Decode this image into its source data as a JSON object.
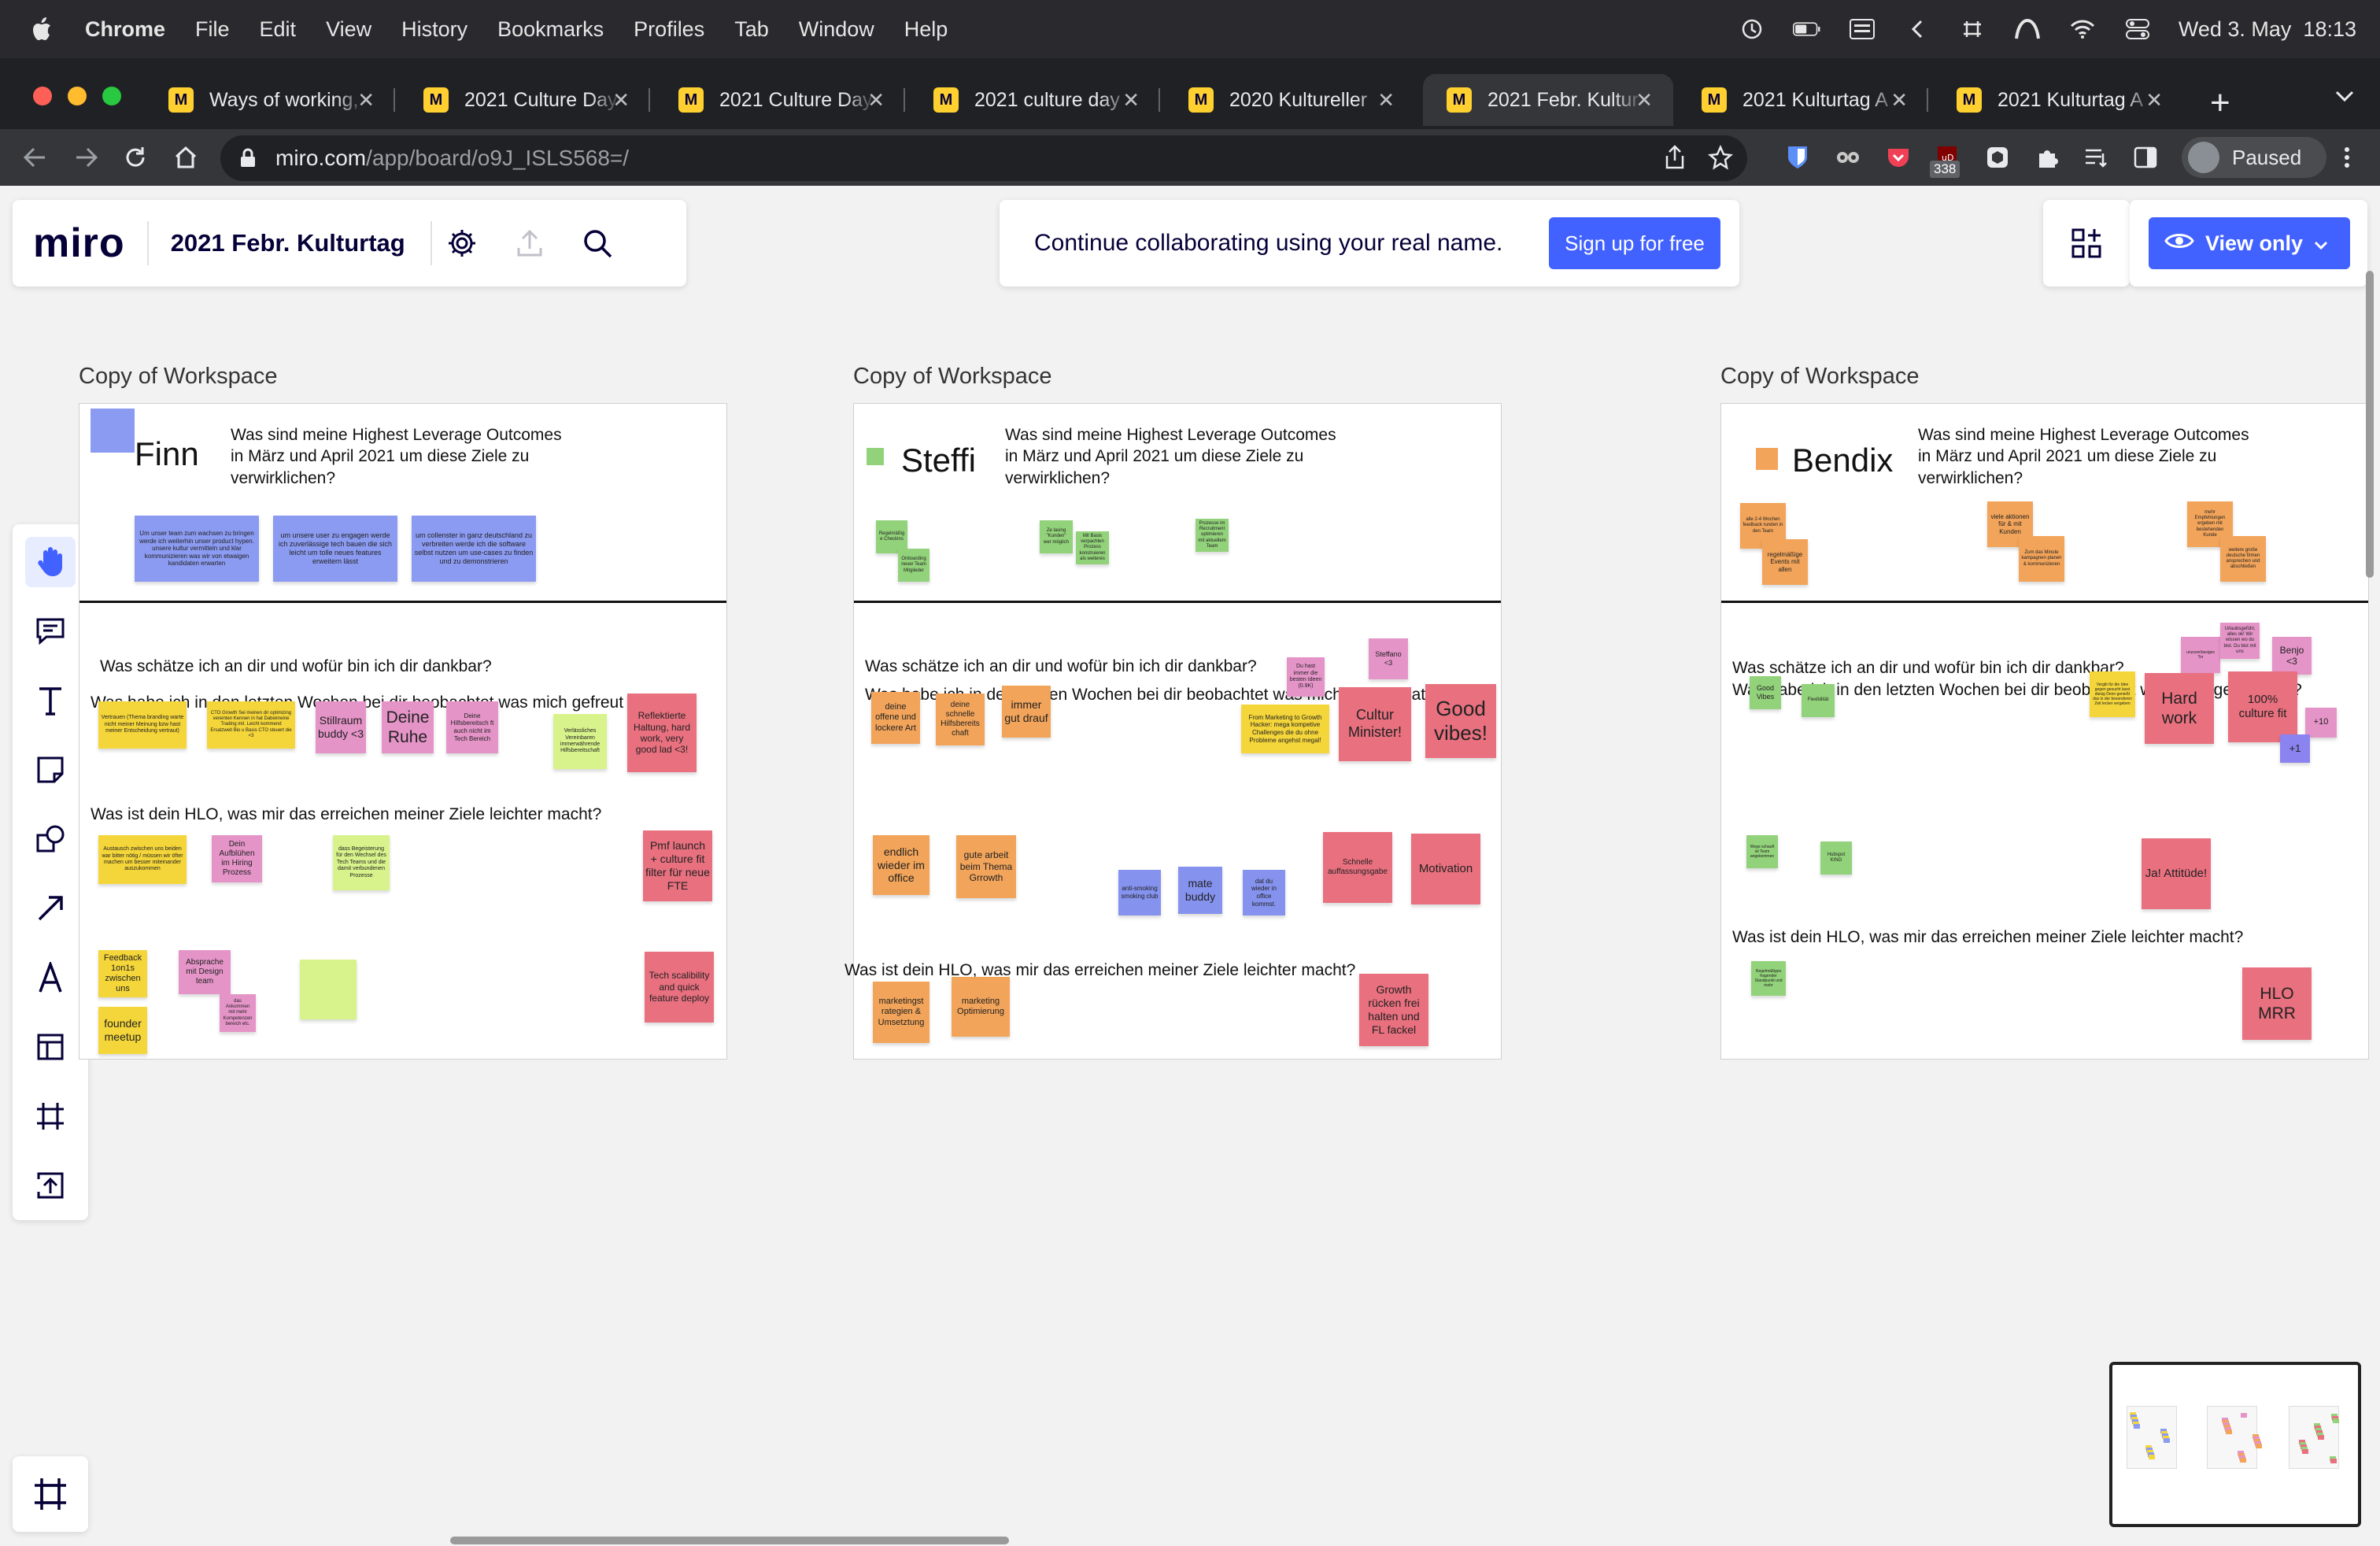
{
  "menubar": {
    "app": "Chrome",
    "items": [
      "File",
      "Edit",
      "View",
      "History",
      "Bookmarks",
      "Profiles",
      "Tab",
      "Window",
      "Help"
    ],
    "datetime": "Wed 3. May  18:13"
  },
  "tabs": [
    {
      "title": "Ways of working,"
    },
    {
      "title": "2021 Culture Day"
    },
    {
      "title": "2021 Culture Day"
    },
    {
      "title": "2021 culture day"
    },
    {
      "title": "2020 Kultureller"
    },
    {
      "title": "2021 Febr. Kultur"
    },
    {
      "title": "2021 Kulturtag A"
    },
    {
      "title": "2021 Kulturtag A"
    }
  ],
  "address": {
    "host": "miro.com",
    "path": "/app/board/o9J_ISLS568=/"
  },
  "profile": {
    "label": "Paused",
    "badge": "338"
  },
  "miro": {
    "logo": "miro",
    "board_title": "2021 Febr. Kulturtag",
    "signup_text": "Continue collaborating using your real name.",
    "signup_button": "Sign up for free",
    "view_button": "View only"
  },
  "frames": [
    {
      "label": "Copy of Workspace",
      "name": "Finn",
      "accent": "#8c9bf2",
      "q1": "Was sind meine Highest Leverage Outcomes in März und April 2021 um diese Ziele zu verwirklichen?",
      "q2": "Was schätze ich an dir und wofür bin ich dir dankbar?",
      "q3": "Was habe ich in den letzten Wochen bei dir beobachtet was mich gefreut hat?",
      "q4": "Was ist dein HLO, was mir das erreichen meiner Ziele leichter macht?",
      "stickies": [
        {
          "t": "Um unser team zum wachsen zu bringen werde ich weiterhin unser product hypen. unsere kultur vermitteln und klar kommunizieren was wir von etwaigen kandidaten erwarten",
          "c": "blue"
        },
        {
          "t": "um unsere user zu engagen werde ich zuverlässige tech bauen die sich leicht um tolle neues features erweitern lässt",
          "c": "blue"
        },
        {
          "t": "um collenster in ganz deutschland zu verbreiten werde ich die software selbst nutzen um use-cases zu finden und zu demonstrieren",
          "c": "blue"
        },
        {
          "t": "Vertrauen (Thema branding warte nicht meiner Meinung bzw hast meiner Entscheidung vertraut)",
          "c": "yellow"
        },
        {
          "t": "CTO Growth Sei meinen dir optimizing vereinten Kennen in hat Dabeimeine Trading mit. Leicht kommend Ersatzweit Bio u Basis CTO steuert die <3",
          "c": "yellow"
        },
        {
          "t": "Stillraum buddy <3",
          "c": "pink"
        },
        {
          "t": "Deine Ruhe",
          "c": "pink"
        },
        {
          "t": "Deine Hilfsbereitsch ft auch nicht im Tech Bereich",
          "c": "pink"
        },
        {
          "t": "Verlässliches Vereinbaren immerwährende Hilfsbereitschaft",
          "c": "lime"
        },
        {
          "t": "Reflektierte Haltung, hard work, very good lad <3!",
          "c": "rose"
        },
        {
          "t": "Austausch zwischen uns beiden war bitter nötig / müssen wir öfter machen um besser miteinander auszukommen",
          "c": "yellow"
        },
        {
          "t": "Dein Aufblühen im Hiring Prozess",
          "c": "pink"
        },
        {
          "t": "dass Begeisterung für den Wechsel des Tech Teams und die damit verbundenen Prozesse",
          "c": "lime"
        },
        {
          "t": "Pmf launch + culture fit filter für neue FTE",
          "c": "rose"
        },
        {
          "t": "Feedback 1on1s zwischen uns",
          "c": "yellow"
        },
        {
          "t": "Absprache mit Design team",
          "c": "pink"
        },
        {
          "t": "das Ankommen mit mehr Kompetenzen bereich etc.",
          "c": "pink"
        },
        {
          "t": "",
          "c": "lime"
        },
        {
          "t": "founder meetup",
          "c": "yellow"
        },
        {
          "t": "Tech scalibility and quick feature deploy",
          "c": "rose"
        }
      ]
    },
    {
      "label": "Copy of Workspace",
      "name": "Steffi",
      "accent": "#92d27a",
      "q1": "Was sind meine Highest Leverage Outcomes in März und April 2021 um diese Ziele zu verwirklichen?",
      "q2": "Was schätze ich an dir und wofür bin ich dir dankbar?",
      "q3": "Was habe ich in den letzten Wochen bei dir beobachtet was mich gefreut hat?",
      "q4": "Was ist dein HLO, was mir das erreichen meiner Ziele leichter macht?",
      "stickies": [
        {
          "t": "Regelmäßige Checkins",
          "c": "green"
        },
        {
          "t": "Onboarding neuer Team Mitglieder",
          "c": "green"
        },
        {
          "t": "Ze lasing \"Kunden\" wer möglich",
          "c": "green"
        },
        {
          "t": "Mit Basis verpachten Prozess konstruieren als weiteres",
          "c": "green"
        },
        {
          "t": "Prozesse im Recruitment optimieren mit aktuellem Team",
          "c": "green"
        },
        {
          "t": "deine offene und lockere Art",
          "c": "orange"
        },
        {
          "t": "deine schnelle Hilfsbereits chaft",
          "c": "orange"
        },
        {
          "t": "immer gut drauf",
          "c": "orange"
        },
        {
          "t": "Du hast immer die besten Ideen (0.9K)",
          "c": "pink"
        },
        {
          "t": "Steffano <3",
          "c": "pink"
        },
        {
          "t": "From Marketing to Growth Hacker: mega kompetive Challenges die du ohne Probleme angehst megal!",
          "c": "yellow"
        },
        {
          "t": "Cultur Minister!",
          "c": "rose"
        },
        {
          "t": "Good vibes!",
          "c": "rose"
        },
        {
          "t": "endlich wieder im office",
          "c": "orange"
        },
        {
          "t": "gute arbeit beim Thema Grrowth",
          "c": "orange"
        },
        {
          "t": "anti-smoking smoking club",
          "c": "indigo"
        },
        {
          "t": "mate buddy",
          "c": "indigo"
        },
        {
          "t": "dat du wieder in office kommst.",
          "c": "indigo"
        },
        {
          "t": "Schnelle auffassungsgabe",
          "c": "rose"
        },
        {
          "t": "Motivation",
          "c": "rose"
        },
        {
          "t": "marketingst rategien & Umsetztung",
          "c": "orange"
        },
        {
          "t": "marketing Optimierung",
          "c": "orange"
        },
        {
          "t": "Growth rücken frei halten und FL fackel",
          "c": "rose"
        }
      ]
    },
    {
      "label": "Copy of Workspace",
      "name": "Bendix",
      "accent": "#f2a45a",
      "q1": "Was sind meine Highest Leverage Outcomes in März und April 2021 um diese Ziele zu verwirklichen?",
      "q2": "Was schätze ich an dir und wofür bin ich dir dankbar?",
      "q3": "Was habe ich in den letzten Wochen bei dir beobachtet was mich gefreut hat?",
      "q4": "Was ist dein HLO, was mir das erreichen meiner Ziele leichter macht?",
      "stickies": [
        {
          "t": "alle 2-4 Wochen feedback runden in den Team",
          "c": "orange"
        },
        {
          "t": "regelmäßige Events mit allen",
          "c": "orange"
        },
        {
          "t": "viele aktionen für & mit Kunden",
          "c": "orange"
        },
        {
          "t": "Zum das Minute kampagnen planen & kommunizieren",
          "c": "orange"
        },
        {
          "t": "mehr Empfehlungen ergeben mit bestehenden Kunde",
          "c": "orange"
        },
        {
          "t": "weitere große deutsche firmen ansprechen und abschließen",
          "c": "orange"
        },
        {
          "t": "Good Vibes",
          "c": "green"
        },
        {
          "t": "Flexibilität",
          "c": "green"
        },
        {
          "t": "unzuverlässiges Tor",
          "c": "pink"
        },
        {
          "t": "Urlaubsgefühl, alles ok! Wir wissen wo du bist. Du bist mit uns",
          "c": "pink"
        },
        {
          "t": "Benjo <3",
          "c": "pink"
        },
        {
          "t": "Vergib für die Idee gegen gesucht lasst diesig Denn genießt das in der besonderen Zeit lecker vergeben",
          "c": "yellow"
        },
        {
          "t": "Hard work",
          "c": "rose"
        },
        {
          "t": "100% culture fit",
          "c": "rose"
        },
        {
          "t": "+10",
          "c": "pink"
        },
        {
          "t": "+1",
          "c": "purple"
        },
        {
          "t": "Wege schauft ist Team angekommen",
          "c": "green"
        },
        {
          "t": "Hubspot KING",
          "c": "green"
        },
        {
          "t": "Ja! Attitüde!",
          "c": "rose"
        },
        {
          "t": "Regelmäßiges fragender Standpunkt und mehr",
          "c": "green"
        },
        {
          "t": "HLO MRR",
          "c": "rose"
        }
      ]
    }
  ]
}
